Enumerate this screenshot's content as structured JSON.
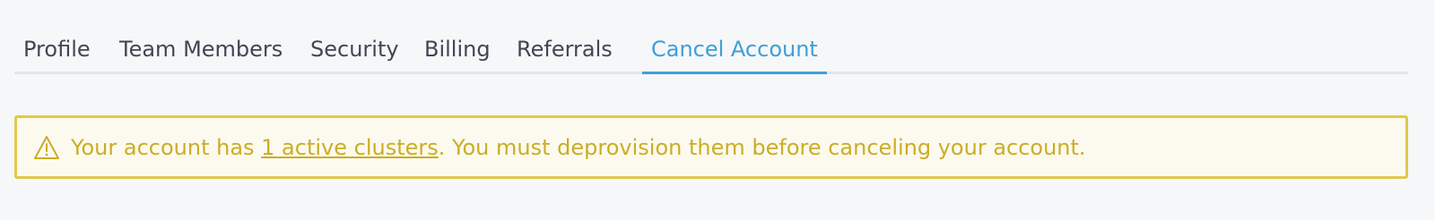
{
  "tabs": [
    {
      "label": "Profile",
      "active": false
    },
    {
      "label": "Team Members",
      "active": false
    },
    {
      "label": "Security",
      "active": false
    },
    {
      "label": "Billing",
      "active": false
    },
    {
      "label": "Referrals",
      "active": false
    },
    {
      "label": "Cancel Account",
      "active": true
    }
  ],
  "alert": {
    "icon": "warning-triangle-icon",
    "text_before": "Your account has ",
    "link_text": "1 active clusters",
    "text_after": ". You must deprovision them before canceling your account."
  },
  "colors": {
    "page_background": "#f6f7f9",
    "tab_text": "#3f4753",
    "active_tab": "#3e9fd8",
    "tab_divider": "#e3e6ea",
    "warning_border": "#e2c84b",
    "warning_background": "#fcfaee",
    "warning_text": "#cbad26"
  }
}
